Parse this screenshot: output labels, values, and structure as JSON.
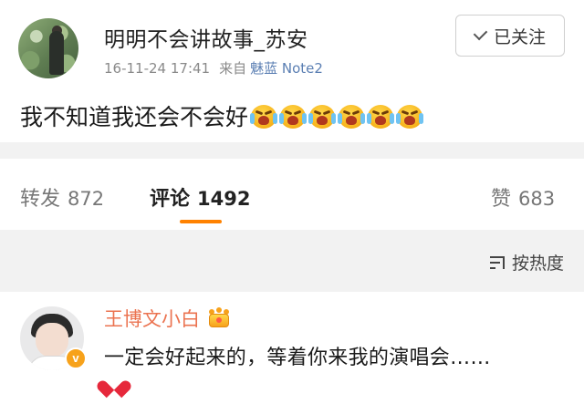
{
  "post": {
    "username": "明明不会讲故事_苏安",
    "timestamp": "16-11-24 17:41",
    "from_label": "来自",
    "device": "魅蓝 Note2",
    "follow_label": "已关注",
    "text": "我不知道我还会不会好",
    "emoji_icon": "cry-emoji",
    "emoji_count": 6
  },
  "tabs": {
    "repost_label": "转发",
    "repost_count": "872",
    "comment_label": "评论",
    "comment_count": "1492",
    "like_label": "赞",
    "like_count": "683"
  },
  "sort": {
    "label": "按热度",
    "icon": "sort-icon"
  },
  "comment": {
    "username": "王博文小白",
    "badge_icon": "crown-icon",
    "verified_icon": "verified-badge-icon",
    "verified_text": "v",
    "text": "一定会好起来的，等着你来我的演唱会……",
    "trailing_icon": "red-heart-icon"
  },
  "colors": {
    "accent": "#ff8200",
    "commenter_name": "#eb7350",
    "device_link": "#5b7fb3",
    "divider_bg": "#f2f2f2"
  }
}
